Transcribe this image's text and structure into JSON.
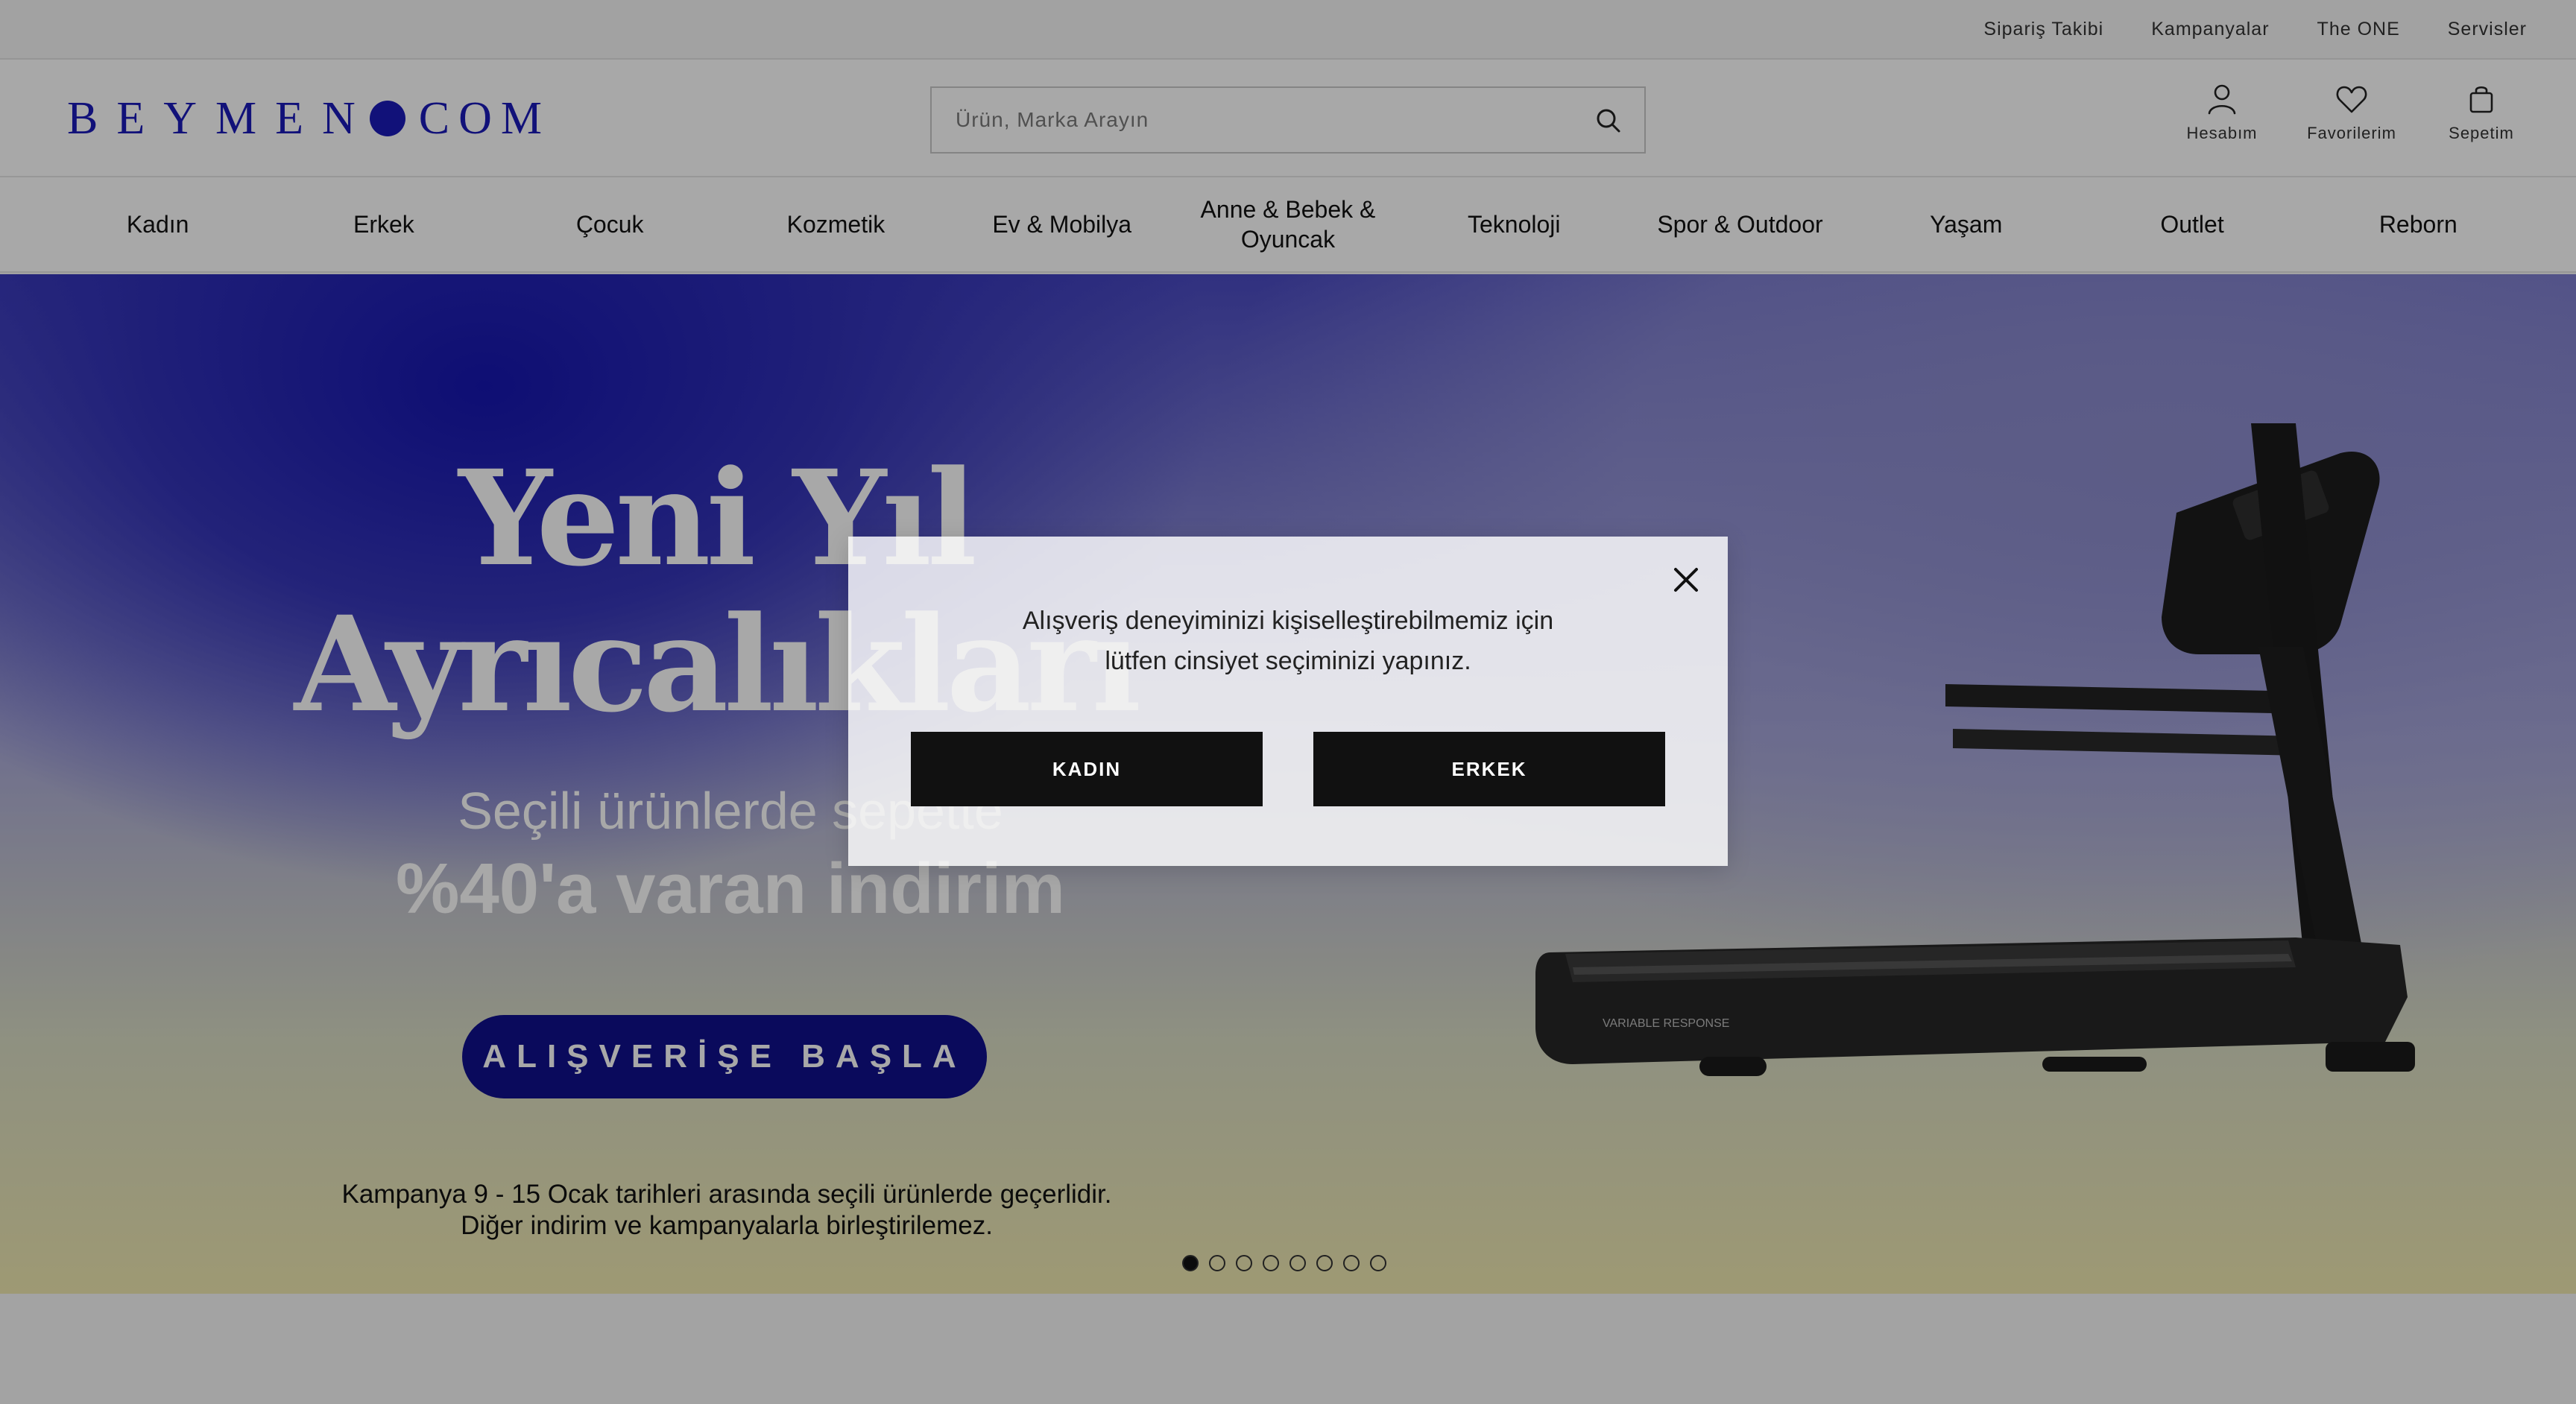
{
  "topbar": {
    "links": [
      "Sipariş Takibi",
      "Kampanyalar",
      "The ONE",
      "Servisler"
    ]
  },
  "header": {
    "logo_left": "BEYMEN",
    "logo_right": "COM",
    "search_placeholder": "Ürün, Marka Arayın",
    "icons": [
      {
        "icon": "user-icon",
        "label": "Hesabım"
      },
      {
        "icon": "heart-icon",
        "label": "Favorilerim"
      },
      {
        "icon": "bag-icon",
        "label": "Sepetim"
      }
    ]
  },
  "nav": {
    "items": [
      "Kadın",
      "Erkek",
      "Çocuk",
      "Kozmetik",
      "Ev & Mobilya",
      "Anne & Bebek & Oyuncak",
      "Teknoloji",
      "Spor & Outdoor",
      "Yaşam",
      "Outlet",
      "Reborn"
    ]
  },
  "hero": {
    "title_line1": "Yeni Yıl",
    "title_line2": "Ayrıcalıkları",
    "sub_line1": "Seçili ürünlerde sepette",
    "sub_line2": "%40'a varan indirim",
    "cta": "ALIŞVERİŞE BAŞLA",
    "terms_line1": "Kampanya 9 - 15 Ocak tarihleri arasında seçili ürünlerde geçerlidir.",
    "terms_line2": "Diğer indirim ve kampanyalarla birleştirilemez.",
    "product_text": "VARIABLE RESPONSE",
    "slide_count": 8,
    "active_slide": 1
  },
  "modal": {
    "message_line1": "Alışveriş deneyiminizi kişiselleştirebilmemiz için",
    "message_line2": "lütfen cinsiyet seçiminizi yapınız.",
    "button_women": "KADIN",
    "button_men": "ERKEK"
  },
  "colors": {
    "brand": "#1a1ab8",
    "cta_bg": "#10108c",
    "button_dark": "#111111"
  }
}
